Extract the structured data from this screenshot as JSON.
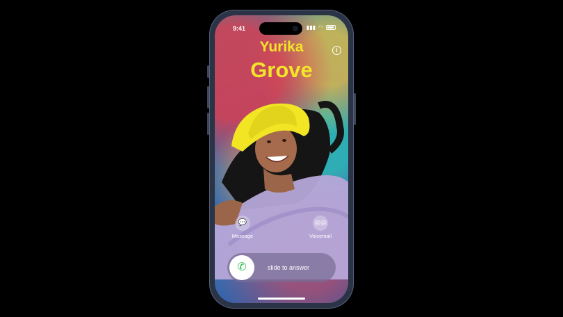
{
  "status_bar": {
    "time": "9:41"
  },
  "caller": {
    "first_name": "Yurika",
    "last_name": "Grove"
  },
  "actions": [
    {
      "label": "Message",
      "icon": "message-bubble-icon"
    },
    {
      "label": "Voicemail",
      "icon": "voicemail-icon"
    }
  ],
  "answer": {
    "slide_label": "slide to answer",
    "icon": "phone-icon"
  },
  "colors": {
    "name": "#f2e52a",
    "accept": "#2fbf4d"
  }
}
